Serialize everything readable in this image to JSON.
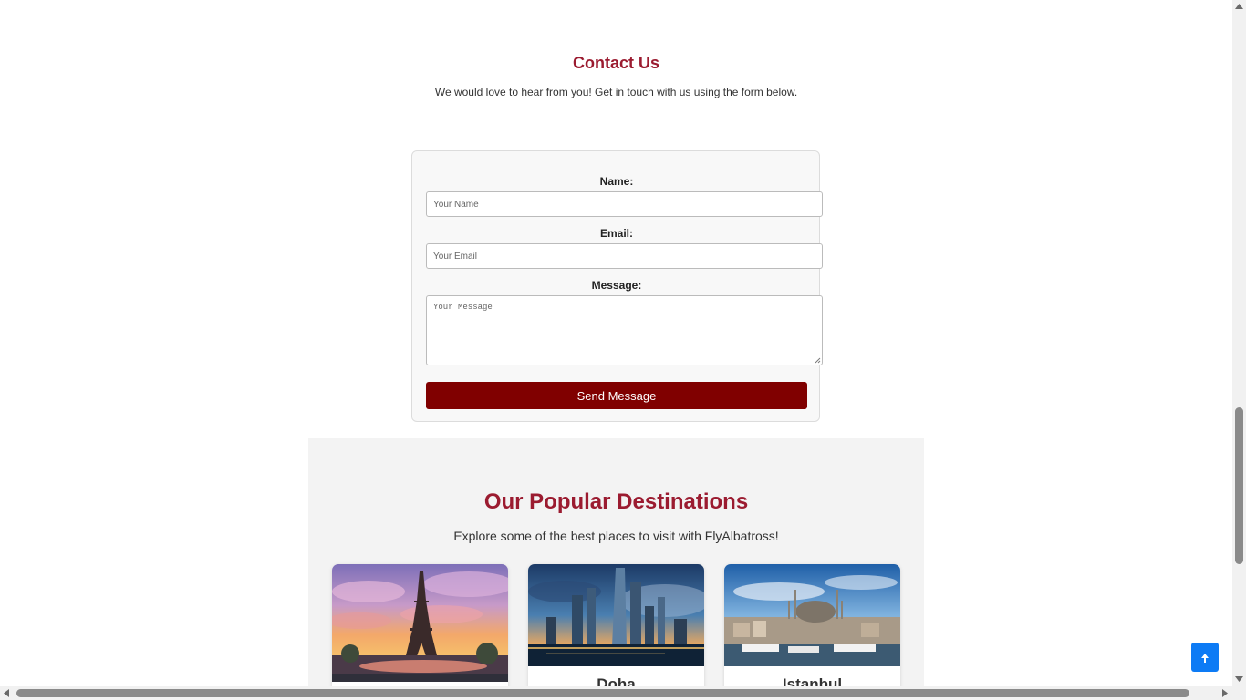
{
  "contact": {
    "title": "Contact Us",
    "subtitle": "We would love to hear from you! Get in touch with us using the form below.",
    "name_label": "Name:",
    "name_placeholder": "Your Name",
    "email_label": "Email:",
    "email_placeholder": "Your Email",
    "message_label": "Message:",
    "message_placeholder": "Your Message",
    "submit_label": "Send Message",
    "submit_color": "#800000"
  },
  "destinations": {
    "title": "Our Popular Destinations",
    "subtitle": "Explore some of the best places to visit with FlyAlbatross!",
    "cards": [
      {
        "name": "",
        "image": "eiffel-tower-paris-sunset"
      },
      {
        "name": "Doha",
        "image": "doha-skyline-night"
      },
      {
        "name": "Istanbul",
        "image": "istanbul-mosque-harbor"
      }
    ]
  },
  "back_to_top": {
    "icon": "arrow-up-icon",
    "color": "#0d7bf5"
  },
  "colors": {
    "heading": "#9b1b30",
    "section_bg": "#f3f3f3"
  }
}
